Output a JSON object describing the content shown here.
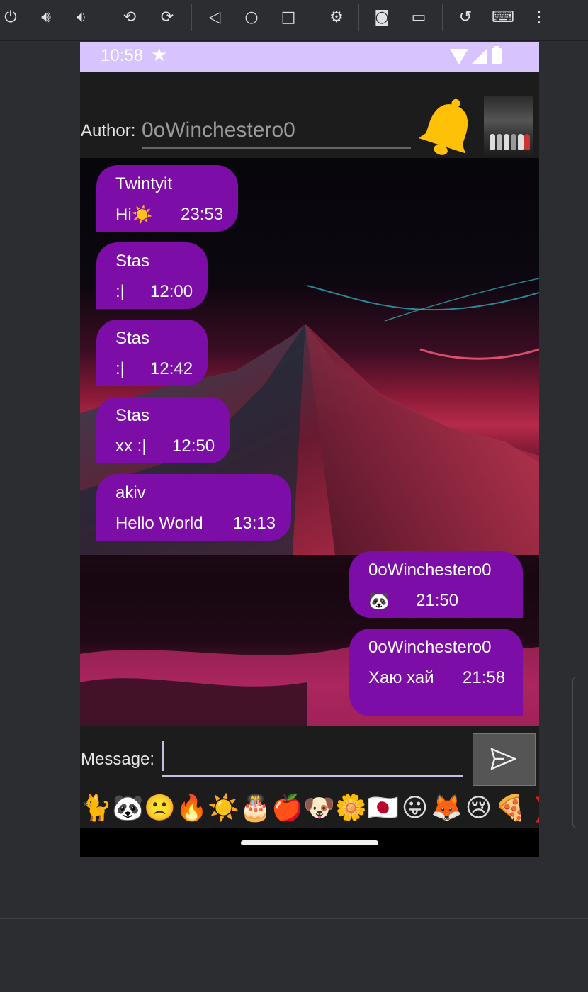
{
  "emulator_toolbar": {
    "icons": [
      "power-icon",
      "volume-up-icon",
      "volume-down-icon",
      "rotate-left-icon",
      "rotate-right-icon",
      "back-icon",
      "home-icon",
      "overview-icon",
      "device-settings-icon",
      "screenshot-icon",
      "screen-record-icon",
      "snapshot-icon",
      "keyboard-icon",
      "more-icon"
    ]
  },
  "statusbar": {
    "time": "10:58"
  },
  "header": {
    "author_label": "Author:",
    "author_value": "0oWinchestero0"
  },
  "messages": [
    {
      "author": "Twintyit",
      "text": "Hi☀️",
      "time": "23:53",
      "side": "left"
    },
    {
      "author": "Stas",
      "text": ":|",
      "time": "12:00",
      "side": "left"
    },
    {
      "author": "Stas",
      "text": ":|",
      "time": "12:42",
      "side": "left"
    },
    {
      "author": "Stas",
      "text": "xx :|",
      "time": "12:50",
      "side": "left"
    },
    {
      "author": "akiv",
      "text": "Hello World",
      "time": "13:13",
      "side": "left"
    },
    {
      "author": "0oWinchestero0",
      "text": "🐼",
      "time": "21:50",
      "side": "right"
    },
    {
      "author": "0oWinchestero0",
      "text": "Хаю хай",
      "time": "21:58",
      "side": "right"
    }
  ],
  "input": {
    "message_label": "Message:",
    "message_value": ""
  },
  "emoji_bar": [
    "🐈",
    "🐼",
    "🙁",
    "🔥",
    "☀️",
    "🎂",
    "🍎",
    "🐶",
    "🌼",
    "🇯🇵",
    "😛",
    "🦊",
    "😢",
    "🍕",
    "❯"
  ],
  "colors": {
    "bubble": "#7c0da6",
    "statusbar": "#d7c4ff",
    "bell": "#ffc107"
  }
}
